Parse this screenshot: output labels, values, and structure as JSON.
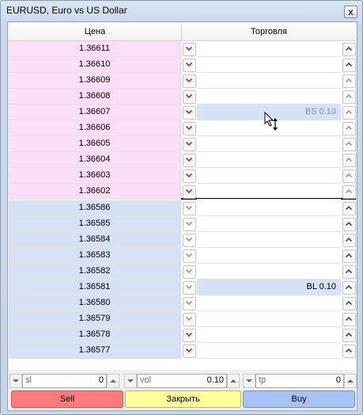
{
  "window": {
    "title": "EURUSD, Euro vs US Dollar",
    "close_glyph": "x"
  },
  "headers": {
    "price": "Цена",
    "trade": "Торговля"
  },
  "ask_rows": [
    {
      "price": "1.36611",
      "down_active": true,
      "up_active": true
    },
    {
      "price": "1.36610",
      "down_active": true,
      "up_active": true
    },
    {
      "price": "1.36609",
      "down_active": true,
      "up_active": false
    },
    {
      "price": "1.36608",
      "down_active": true,
      "up_active": false
    },
    {
      "price": "1.36607",
      "down_active": true,
      "up_active": false,
      "order": "BS 0.10"
    },
    {
      "price": "1.36606",
      "down_active": true,
      "up_active": false
    },
    {
      "price": "1.36605",
      "down_active": true,
      "up_active": false
    },
    {
      "price": "1.36604",
      "down_active": true,
      "up_active": false
    },
    {
      "price": "1.36603",
      "down_active": true,
      "up_active": false
    },
    {
      "price": "1.36602",
      "down_active": true,
      "up_active": false
    }
  ],
  "bid_rows": [
    {
      "price": "1.36586",
      "down_active": false,
      "up_active": true
    },
    {
      "price": "1.36585",
      "down_active": false,
      "up_active": true
    },
    {
      "price": "1.36584",
      "down_active": false,
      "up_active": true
    },
    {
      "price": "1.36583",
      "down_active": false,
      "up_active": true
    },
    {
      "price": "1.36582",
      "down_active": false,
      "up_active": true
    },
    {
      "price": "1.36581",
      "down_active": false,
      "up_active": true,
      "order": "BL 0.10"
    },
    {
      "price": "1.36580",
      "down_active": false,
      "up_active": true
    },
    {
      "price": "1.36579",
      "down_active": false,
      "up_active": true
    },
    {
      "price": "1.36578",
      "down_active": true,
      "up_active": true
    },
    {
      "price": "1.36577",
      "down_active": true,
      "up_active": true
    }
  ],
  "inputs": {
    "sl": {
      "label": "sl",
      "value": "0"
    },
    "vol": {
      "label": "vol",
      "value": "0.10"
    },
    "tp": {
      "label": "tp",
      "value": "0"
    }
  },
  "buttons": {
    "sell": "Sell",
    "close": "Закрыть",
    "buy": "Buy"
  },
  "colors": {
    "ask_bg": "#fbdff7",
    "bid_bg": "#d4e1f7",
    "order_bg": "#d6e2f5",
    "arrow_down_active": "#d0202a",
    "arrow_up_active": "#2a3fb8",
    "arrow_inactive": "#9a9a9a",
    "sell": "#ff7a7a",
    "close": "#ffff99",
    "buy": "#a6c2f7"
  },
  "icons": {
    "down": "chevron-down-icon",
    "up": "chevron-up-icon",
    "cursor": "move-cursor-icon"
  }
}
